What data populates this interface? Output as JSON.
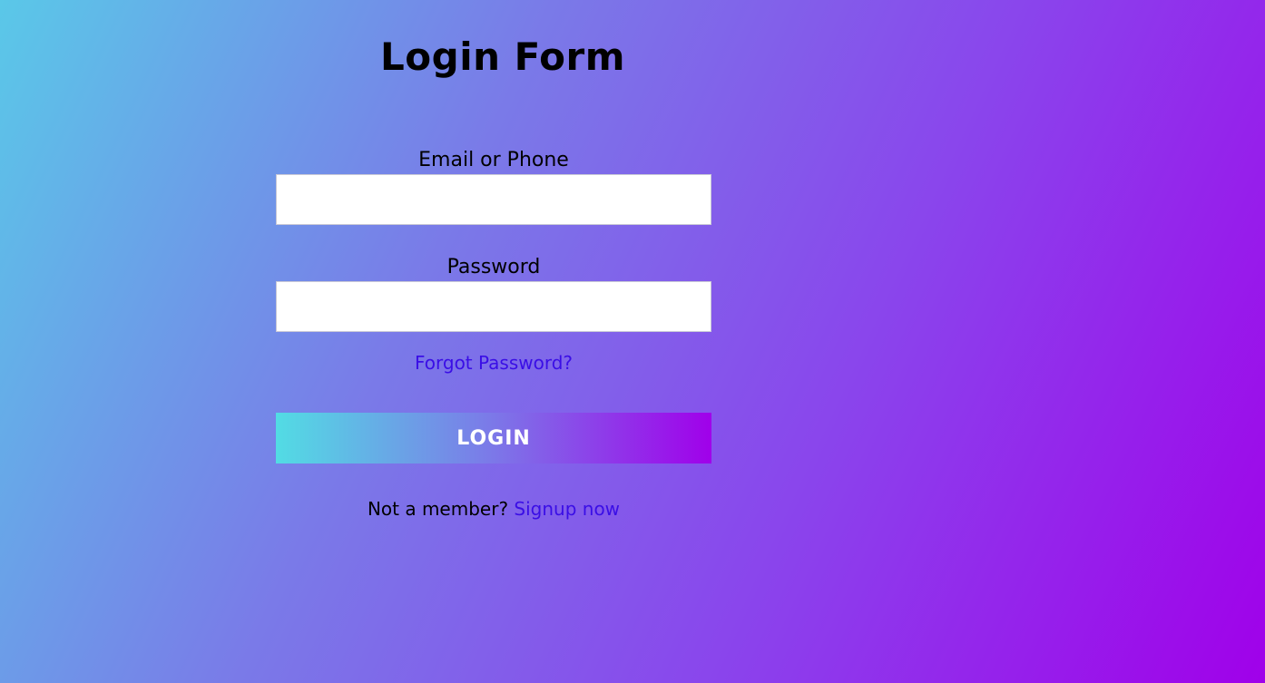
{
  "form": {
    "title": "Login Form",
    "email_label": "Email or Phone",
    "email_value": "",
    "password_label": "Password",
    "password_value": "",
    "forgot_link": "Forgot Password?",
    "login_button": "LOGIN",
    "signup_prompt": "Not a member?",
    "signup_link": "Signup now"
  },
  "colors": {
    "background_start": "#5ac8e8",
    "background_end": "#a000ea",
    "link": "#3a0ee6",
    "button_start": "#52dce4",
    "button_end": "#a000ea",
    "input_background": "#ffffff"
  }
}
